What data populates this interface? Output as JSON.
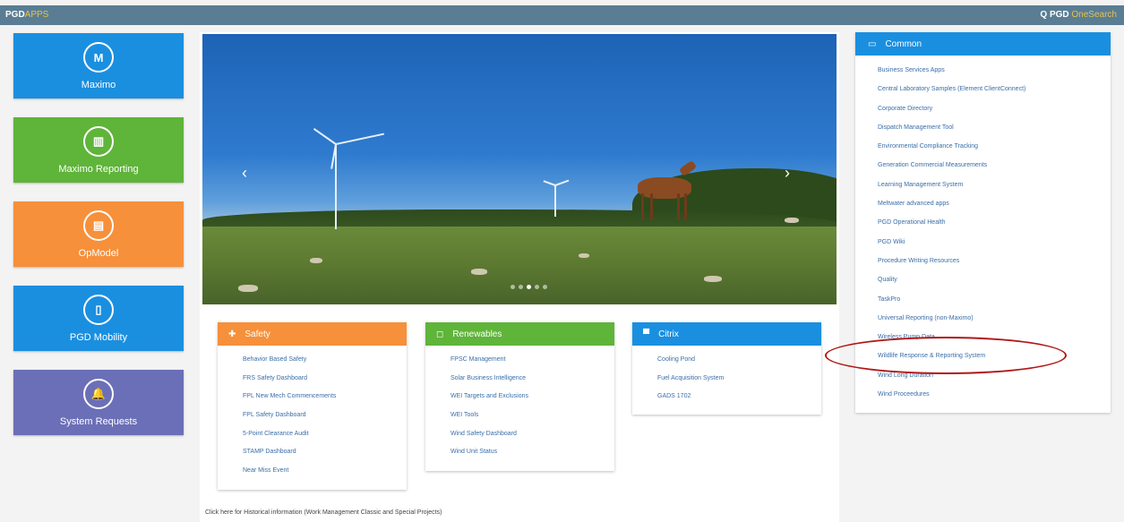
{
  "header": {
    "brand": "PGD",
    "brand_suffix": "APPS",
    "search_label": "Q PGD",
    "search_suffix": "OneSearch"
  },
  "tiles": [
    {
      "label": "Maximo",
      "icon": "M",
      "color": "#1a8fe0"
    },
    {
      "label": "Maximo Reporting",
      "icon": "▥",
      "color": "#5fb43a"
    },
    {
      "label": "OpModel",
      "icon": "▤",
      "color": "#f6903a"
    },
    {
      "label": "PGD Mobility",
      "icon": "▯",
      "color": "#1a8fe0"
    },
    {
      "label": "System Requests",
      "icon": "🔔",
      "color": "#6b6fb7"
    }
  ],
  "carousel": {
    "prev": "‹",
    "next": "›"
  },
  "cards": {
    "safety": {
      "title": "Safety",
      "color": "#f6903a",
      "icon": "✚",
      "items": [
        "Behavior Based Safety",
        "FRS Safety Dashboard",
        "FPL New Mech Commencements",
        "FPL Safety Dashboard",
        "5-Point Clearance Audit",
        "STAMP Dashboard",
        "Near Miss Event"
      ]
    },
    "renewables": {
      "title": "Renewables",
      "color": "#5fb43a",
      "icon": "◻",
      "items": [
        "FPSC Management",
        "Solar Business Intelligence",
        "WEI Targets and Exclusions",
        "WEI Tools",
        "Wind Safety Dashboard",
        "Wind Unit Status"
      ]
    },
    "citrix": {
      "title": "Citrix",
      "color": "#1a8fe0",
      "icon": "▀",
      "items": [
        "Cooling Pond",
        "Fuel Acquisition System",
        "GADS 1702"
      ]
    }
  },
  "common": {
    "title": "Common",
    "icon": "▭",
    "items": [
      "Business Services Apps",
      "Central Laboratory Samples (Element ClientConnect)",
      "Corporate Directory",
      "Dispatch Management Tool",
      "Environmental Compliance Tracking",
      "Generation Commercial Measurements",
      "Learning Management System",
      "Meltwater advanced apps",
      "PGD Operational Health",
      "PGD Wiki",
      "Procedure Writing Resources",
      "Quality",
      "TaskPro",
      "Universal Reporting (non-Maximo)",
      "Wireless Pump Data",
      "Wildlife Response & Reporting System",
      "Wind Long Duration",
      "Wind Proceedures"
    ]
  },
  "footer": "Click here for Historical information (Work Management Classic and Special Projects)"
}
